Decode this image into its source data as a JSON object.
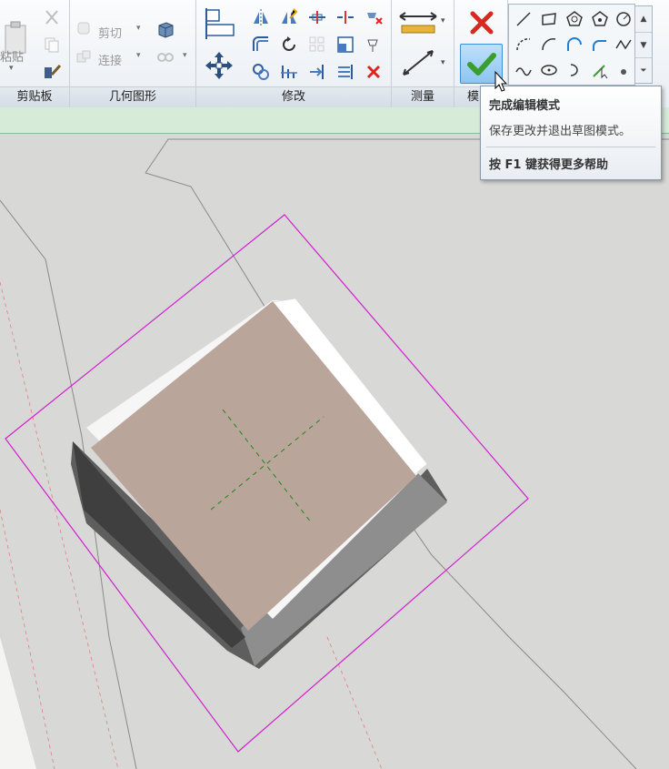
{
  "ribbon": {
    "panels": {
      "clipboard": "剪贴板",
      "geometry": "几何图形",
      "modify": "修改",
      "measure": "测量",
      "mode": "模"
    },
    "clipboard": {
      "paste_label": "粘贴"
    },
    "geometry": {
      "cut_label": "剪切",
      "join_label": "连接"
    }
  },
  "tooltip": {
    "title": "完成编辑模式",
    "description": "保存更改并退出草图模式。",
    "help": "按 F1 键获得更多帮助"
  },
  "colors": {
    "accent_green": "#3a9e2e",
    "cancel_red": "#d9281f",
    "boundary_magenta": "#d020d0",
    "face_tan": "#b9a59a"
  }
}
